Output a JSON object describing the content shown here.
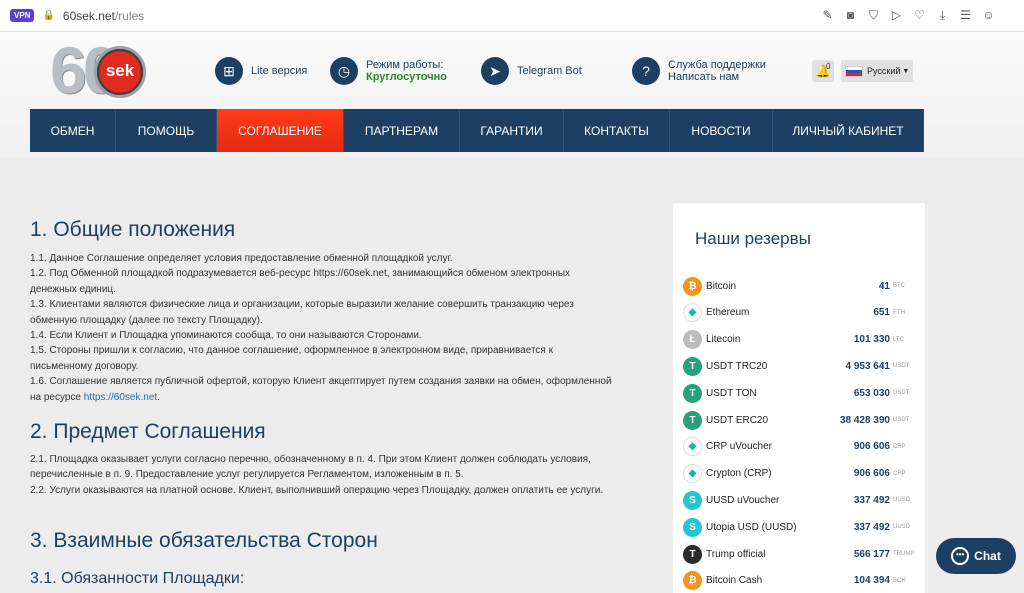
{
  "browser": {
    "vpn": "VPN",
    "url_host": "60sek.net",
    "url_path": "/rules"
  },
  "logo": {
    "number": "60",
    "text": "sek"
  },
  "header": {
    "lite": "Lite версия",
    "mode_label": "Режим работы:",
    "mode_value": "Круглосуточно",
    "telegram": "Telegram Bot",
    "support_line1": "Служба поддержки",
    "support_line2": "Написать нам",
    "notif_count": "0",
    "language": "Русский"
  },
  "nav": [
    {
      "label": "ОБМЕН",
      "width": 86
    },
    {
      "label": "ПОМОЩЬ",
      "width": 101
    },
    {
      "label": "СОГЛАШЕНИЕ",
      "width": 127,
      "active": true
    },
    {
      "label": "ПАРТНЕРАМ",
      "width": 116
    },
    {
      "label": "ГАРАНТИИ",
      "width": 104
    },
    {
      "label": "КОНТАКТЫ",
      "width": 106
    },
    {
      "label": "НОВОСТИ",
      "width": 103
    },
    {
      "label": "ЛИЧНЫЙ КАБИНЕТ",
      "width": 151
    }
  ],
  "content": {
    "s1_title": "1. Общие положения",
    "s1_p1": "1.1. Данное Соглашение определяет условия предоставление обменной площадкой услуг.",
    "s1_p2": "1.2. Под Обменной площадкой подразумевается веб-ресурс https://60sek.net, занимающийся обменом электронных денежных единиц.",
    "s1_p3": "1.3. Клиентами являются физические лица и организации, которые выразили желание совершить транзакцию через обменную площадку (далее по тексту Площадку).",
    "s1_p4": "1.4. Если Клиент и Площадка упоминаются сообща, то они называются Сторонами.",
    "s1_p5": "1.5. Стороны пришли к согласию, что данное соглашение, оформленное в электронном виде, приравнивается к письменному договору.",
    "s1_p6": "1.6. Соглашение является публичной офертой, которую Клиент акцептирует путем создания заявки на обмен, оформленной на ресурсе",
    "s1_link": "https://60sek.net",
    "s2_title": "2. Предмет Соглашения",
    "s2_p1": "2.1. Площадка оказывает услуги согласно перечню, обозначенному в п. 4. При этом Клиент должен соблюдать условия, перечисленные в п. 9. Предоставление услуг регулируется Регламентом, изложенным в п. 5.",
    "s2_p2": "2.2. Услуги оказываются на платной основе. Клиент, выполнивший операцию через Площадку, должен оплатить ее услуги.",
    "s3_title": "3. Взаимные обязательства Сторон",
    "s31_title": "3.1. Обязанности Площадки:"
  },
  "reserves": {
    "title": "Наши резервы",
    "items": [
      {
        "name": "Bitcoin",
        "amount": "41",
        "unit": "BTC",
        "color": "#f7931a",
        "glyph": "₿"
      },
      {
        "name": "Ethereum",
        "amount": "651",
        "unit": "ETH",
        "color": "#ffffff",
        "glyph": "◆"
      },
      {
        "name": "Litecoin",
        "amount": "101 330",
        "unit": "LTC",
        "color": "#bfbbbb",
        "glyph": "Ł"
      },
      {
        "name": "USDT TRC20",
        "amount": "4 953 641",
        "unit": "USDT",
        "color": "#26a17b",
        "glyph": "T"
      },
      {
        "name": "USDT TON",
        "amount": "653 030",
        "unit": "USDT",
        "color": "#26a17b",
        "glyph": "T"
      },
      {
        "name": "USDT ERC20",
        "amount": "38 428 390",
        "unit": "USDT",
        "color": "#26a17b",
        "glyph": "T"
      },
      {
        "name": "CRP uVoucher",
        "amount": "906 606",
        "unit": "CRP",
        "color": "#ffffff",
        "glyph": "◆"
      },
      {
        "name": "Crypton (CRP)",
        "amount": "906 606",
        "unit": "CRP",
        "color": "#ffffff",
        "glyph": "◆"
      },
      {
        "name": "UUSD uVoucher",
        "amount": "337 492",
        "unit": "UUSD",
        "color": "#1fc7d4",
        "glyph": "S"
      },
      {
        "name": "Utopia USD (UUSD)",
        "amount": "337 492",
        "unit": "UUSD",
        "color": "#1fc7d4",
        "glyph": "S"
      },
      {
        "name": "Trump official",
        "amount": "566 177",
        "unit": "TRUMP",
        "color": "#2b2b2b",
        "glyph": "T"
      },
      {
        "name": "Bitcoin Cash",
        "amount": "104 394",
        "unit": "BCH",
        "color": "#f7931a",
        "glyph": "₿"
      }
    ]
  },
  "chat": {
    "label": "Chat"
  },
  "colors": {
    "primary": "#1d3f63",
    "accent": "#e42a10",
    "green": "#2a8a2a"
  }
}
